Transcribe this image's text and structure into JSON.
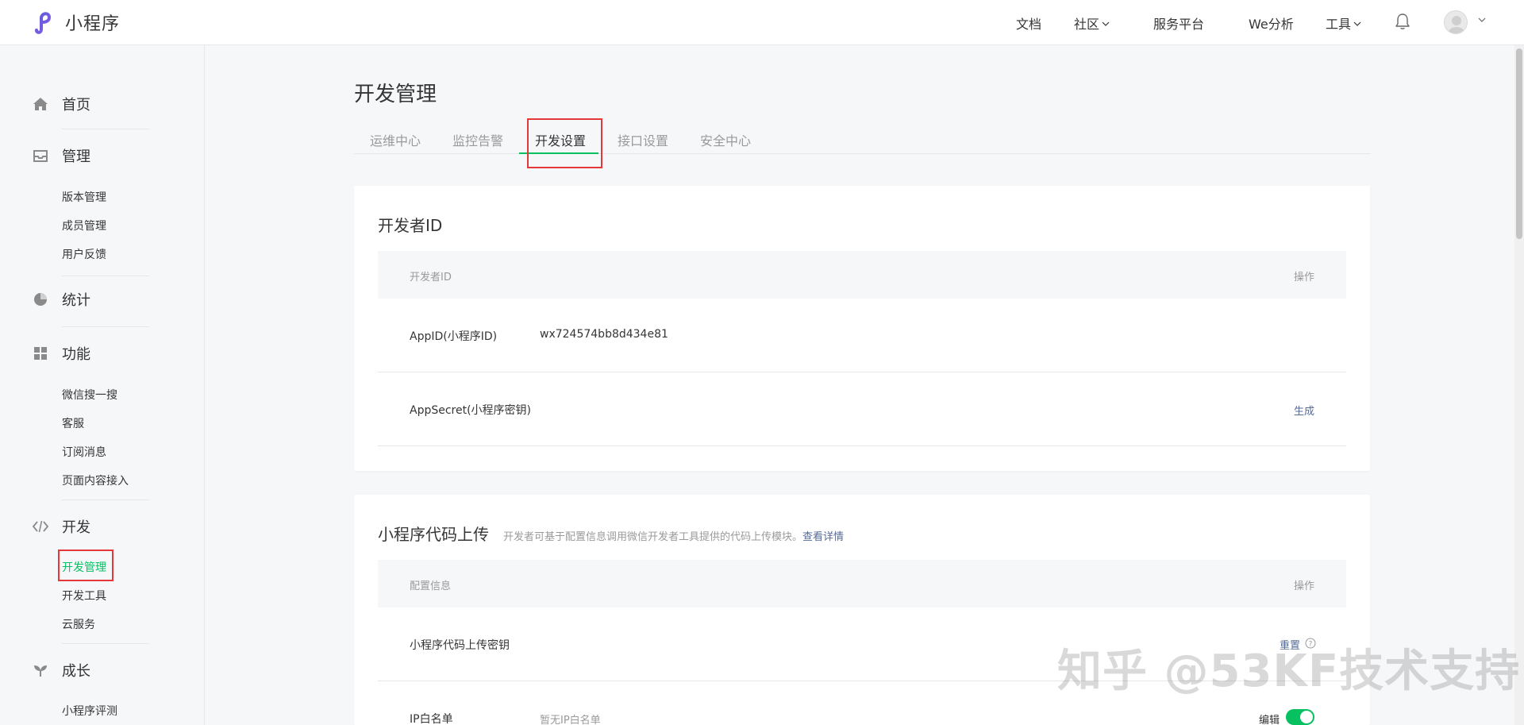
{
  "header": {
    "brand": "小程序",
    "nav": [
      {
        "label": "文档",
        "dropdown": false
      },
      {
        "label": "社区",
        "dropdown": true
      },
      {
        "label": "服务平台",
        "dropdown": false
      },
      {
        "label": "We分析",
        "dropdown": false
      },
      {
        "label": "工具",
        "dropdown": true
      }
    ],
    "icons": {
      "logo": "mini-program-logo-icon",
      "notifications": "bell-icon",
      "avatar": "user-avatar"
    }
  },
  "sidebar": {
    "categories": [
      {
        "label": "首页",
        "icon": "home-icon",
        "items": []
      },
      {
        "label": "管理",
        "icon": "inbox-icon",
        "items": [
          "版本管理",
          "成员管理",
          "用户反馈"
        ]
      },
      {
        "label": "统计",
        "icon": "pie-chart-icon",
        "items": []
      },
      {
        "label": "功能",
        "icon": "grid-icon",
        "items": [
          "微信搜一搜",
          "客服",
          "订阅消息",
          "页面内容接入"
        ]
      },
      {
        "label": "开发",
        "icon": "code-icon",
        "items": [
          "开发管理",
          "开发工具",
          "云服务"
        ]
      },
      {
        "label": "成长",
        "icon": "sprout-icon",
        "items": [
          "小程序评测"
        ]
      }
    ],
    "active_item": "开发管理"
  },
  "main": {
    "title": "开发管理",
    "tabs": [
      "运维中心",
      "监控告警",
      "开发设置",
      "接口设置",
      "安全中心"
    ],
    "active_tab": "开发设置",
    "developer_id_card": {
      "title": "开发者ID",
      "head_left": "开发者ID",
      "head_right": "操作",
      "rows": [
        {
          "label": "AppID(小程序ID)",
          "value": "wx724574bb8d434e81",
          "action": ""
        },
        {
          "label": "AppSecret(小程序密钥)",
          "value": "",
          "action": "生成"
        }
      ]
    },
    "upload_card": {
      "title": "小程序代码上传",
      "desc": "开发者可基于配置信息调用微信开发者工具提供的代码上传模块。",
      "link": "查看详情",
      "head_left": "配置信息",
      "head_right": "操作",
      "rows": [
        {
          "label": "小程序代码上传密钥",
          "value": "",
          "action": "重置"
        },
        {
          "label": "IP白名单",
          "value": "暂无IP白名单",
          "action": "编辑"
        }
      ]
    }
  },
  "watermark": "知乎 @53KF技术支持",
  "colors": {
    "accent": "#07c160",
    "link": "#576b95",
    "highlight_box": "#e5383b"
  }
}
